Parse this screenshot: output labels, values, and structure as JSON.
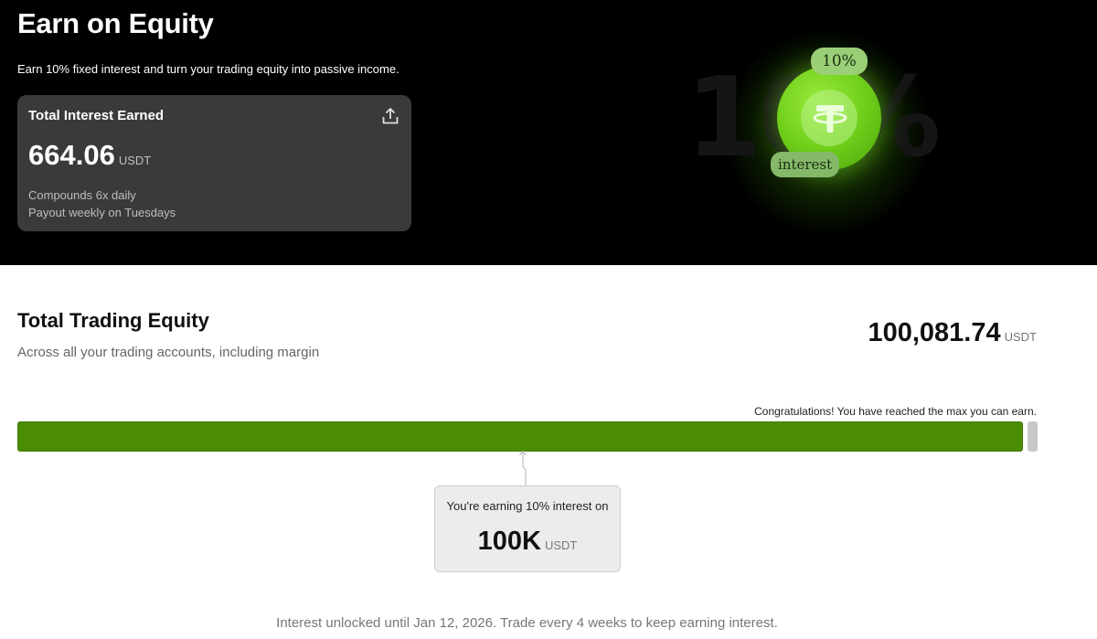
{
  "hero": {
    "title": "Earn on Equity",
    "subtitle": "Earn 10% fixed interest and turn your trading equity into passive income.",
    "illustration": {
      "background_text": "10%",
      "badge_percent": "10%",
      "badge_label": "interest",
      "coin_icon": "tether-icon",
      "accent_color": "#6fcf1a"
    }
  },
  "interest_card": {
    "title": "Total Interest Earned",
    "share_icon": "share-upload-icon",
    "amount": "664.06",
    "unit": "USDT",
    "compounds": "Compounds 6x daily",
    "payout": "Payout weekly on Tuesdays"
  },
  "equity": {
    "title": "Total Trading Equity",
    "subtitle": "Across all your trading accounts, including margin",
    "amount": "100,081.74",
    "unit": "USDT"
  },
  "progress": {
    "message": "Congratulations! You have reached the max you can earn.",
    "fill_fraction": 0.99,
    "fill_color": "#4a8c04",
    "cap_color": "#c8c8c8"
  },
  "earning_tooltip": {
    "text": "You're earning 10% interest on",
    "amount": "100K",
    "unit": "USDT"
  },
  "footer_note": "Interest unlocked until Jan 12, 2026. Trade every 4 weeks to keep earning interest."
}
